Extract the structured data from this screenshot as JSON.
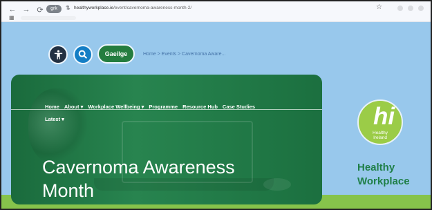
{
  "browser": {
    "pill": "grk",
    "site_icon": "⇅",
    "url_domain": "healthyworkplace.ie",
    "url_path": "/event/cavernoma-awareness-month-2/"
  },
  "page": {
    "gaeilge_label": "Gaeilge",
    "breadcrumb": "Home > Events > Cavernoma Aware...",
    "menu": [
      "Home",
      "About ▾",
      "Workplace Wellbeing ▾",
      "Programme",
      "Resource Hub",
      "Case Studies"
    ],
    "menu_second": "Latest ▾",
    "title": "Cavernoma Awareness Month",
    "logo_hi": "hi",
    "logo_text": "Healthy\nIreland",
    "brand": "Healthy\nWorkplace"
  }
}
